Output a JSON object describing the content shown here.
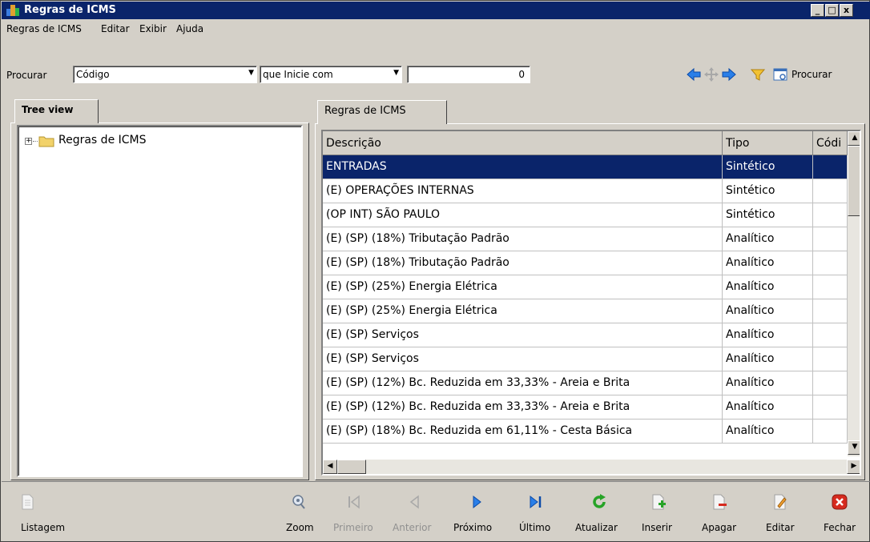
{
  "window": {
    "title": "Regras de ICMS",
    "controls": [
      "_",
      "□",
      "x"
    ]
  },
  "menu": [
    "Regras de ICMS",
    "Editar",
    "Exibir",
    "Ajuda"
  ],
  "search": {
    "label": "Procurar",
    "field": "Código",
    "operator": "que Inicie com",
    "value": "0",
    "find_label": "Procurar"
  },
  "left_tab": "Tree view",
  "tree": {
    "root_label": "Regras de ICMS",
    "expander": "+"
  },
  "right_tab": "Regras de ICMS",
  "grid": {
    "columns": [
      "Descrição",
      "Tipo",
      "Códi"
    ],
    "selected_index": 0,
    "rows": [
      [
        "ENTRADAS",
        "Sintético"
      ],
      [
        "(E) OPERAÇÕES INTERNAS",
        "Sintético"
      ],
      [
        "(OP INT) SÃO PAULO",
        "Sintético"
      ],
      [
        "(E) (SP) (18%) Tributação Padrão",
        "Analítico"
      ],
      [
        "(E) (SP) (18%) Tributação Padrão",
        "Analítico"
      ],
      [
        "(E) (SP) (25%) Energia Elétrica",
        "Analítico"
      ],
      [
        "(E) (SP) (25%) Energia Elétrica",
        "Analítico"
      ],
      [
        "(E) (SP) Serviços",
        "Analítico"
      ],
      [
        "(E) (SP) Serviços",
        "Analítico"
      ],
      [
        "(E) (SP) (12%) Bc. Reduzida em 33,33% - Areia e Brita",
        "Analítico"
      ],
      [
        "(E) (SP) (12%) Bc. Reduzida em 33,33% - Areia e Brita",
        "Analítico"
      ],
      [
        "(E) (SP) (18%) Bc. Reduzida em 61,11% - Cesta Básica",
        "Analítico"
      ]
    ]
  },
  "toolbar": {
    "listagem": "Listagem",
    "zoom": "Zoom",
    "primeiro": "Primeiro",
    "anterior": "Anterior",
    "proximo": "Próximo",
    "ultimo": "Último",
    "atualizar": "Atualizar",
    "inserir": "Inserir",
    "apagar": "Apagar",
    "editar": "Editar",
    "fechar": "Fechar"
  },
  "colors": {
    "titlebar": "#0a246a",
    "selection": "#0a246a",
    "face": "#d4d0c8",
    "nav_blue": "#1e6fd9",
    "green": "#27a327",
    "red": "#d62a1e"
  }
}
